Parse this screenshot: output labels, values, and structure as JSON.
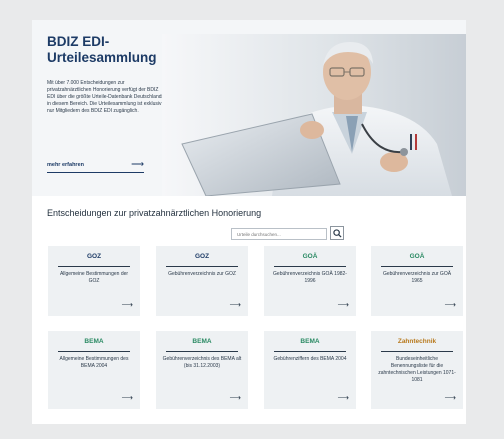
{
  "hero": {
    "title": "BDIZ EDI-Urteilesammlung",
    "description": "Mit über 7.000 Entscheidungen zur privatzahnärztlichen Honorierung verfügt der BDIZ EDI über die größte Urteile-Datenbank Deutschlands in diesem Bereich. Die Urteilesammlung ist exklusiv nur Mitgliedern des BDIZ EDI zugänglich.",
    "link_label": "mehr erfahren",
    "link_arrow": "⟶"
  },
  "section": {
    "title": "Entscheidungen zur privatzahnärztlichen Honorierung"
  },
  "search": {
    "placeholder": "Urteile durchsuchen...",
    "button_icon": "search-icon"
  },
  "colors": {
    "navy": "#1d3b66",
    "green": "#2a8a63",
    "orange": "#b87a1e",
    "card_bg": "#eef1f3"
  },
  "cards": [
    {
      "category": "GOZ",
      "color": "#1d3b66",
      "description": "Allgemeine Bestimmungen der GOZ",
      "arrow": "⟶"
    },
    {
      "category": "GOZ",
      "color": "#1d3b66",
      "description": "Gebührenverzeichnis zur GOZ",
      "arrow": "⟶"
    },
    {
      "category": "GOÄ",
      "color": "#2a8a63",
      "description": "Gebührenverzeichnis GOÄ 1982-1996",
      "arrow": "⟶"
    },
    {
      "category": "GOÄ",
      "color": "#2a8a63",
      "description": "Gebührenverzeichnis zur GOÄ 1965",
      "arrow": "⟶"
    },
    {
      "category": "BEMA",
      "color": "#2a8a63",
      "description": "Allgemeine Bestimmungen des BEMA 2004",
      "arrow": "⟶"
    },
    {
      "category": "BEMA",
      "color": "#2a8a63",
      "description": "Gebührenverzeichnis des BEMA alt (bis 31.12.2003)",
      "arrow": "⟶"
    },
    {
      "category": "BEMA",
      "color": "#2a8a63",
      "description": "Gebührenziffern des BEMA 2004",
      "arrow": "⟶"
    },
    {
      "category": "Zahntechnik",
      "color": "#b87a1e",
      "description": "Bundeseinheitliche Benennungsliste für die zahntechnischen Leistungen 1071-1081",
      "arrow": "⟶"
    }
  ]
}
